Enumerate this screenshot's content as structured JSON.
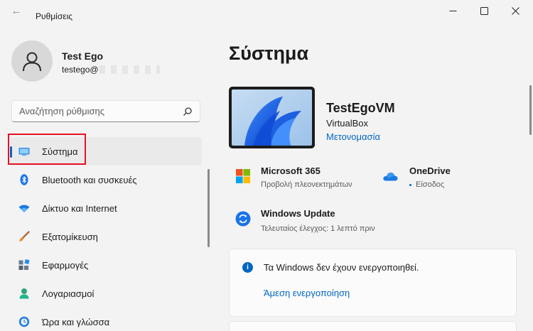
{
  "window": {
    "title": "Ρυθμίσεις",
    "back_glyph": "←"
  },
  "user": {
    "name": "Test Ego",
    "email_prefix": "testego@"
  },
  "search": {
    "placeholder": "Αναζήτηση ρύθμισης"
  },
  "sidebar": {
    "items": [
      {
        "label": "Σύστημα",
        "icon": "system-display-icon",
        "active": true
      },
      {
        "label": "Bluetooth και συσκευές",
        "icon": "bluetooth-icon"
      },
      {
        "label": "Δίκτυο και Internet",
        "icon": "wifi-icon"
      },
      {
        "label": "Εξατομίκευση",
        "icon": "brush-icon"
      },
      {
        "label": "Εφαρμογές",
        "icon": "apps-icon"
      },
      {
        "label": "Λογαριασμοί",
        "icon": "account-icon"
      },
      {
        "label": "Ώρα και γλώσσα",
        "icon": "clock-globe-icon"
      }
    ]
  },
  "main": {
    "title": "Σύστημα",
    "device": {
      "name": "TestEgoVM",
      "model": "VirtualBox",
      "rename_label": "Μετονομασία"
    },
    "tiles": [
      {
        "title": "Microsoft 365",
        "subtitle": "Προβολή πλεονεκτημάτων",
        "icon": "microsoft-365-icon"
      },
      {
        "title": "OneDrive",
        "subtitle": "Είσοδος",
        "icon": "onedrive-icon"
      },
      {
        "title": "Windows Update",
        "subtitle": "Τελευταίος έλεγχος: 1 λεπτό πριν",
        "icon": "windows-update-icon"
      }
    ],
    "activation": {
      "message": "Τα Windows δεν έχουν ενεργοποιηθεί.",
      "link": "Άμεση ενεργοποίηση",
      "info_glyph": "i"
    }
  },
  "colors": {
    "accent": "#0067c0",
    "highlight": "#e81123",
    "background": "#f3f3f3",
    "card": "#fbfbfb"
  }
}
